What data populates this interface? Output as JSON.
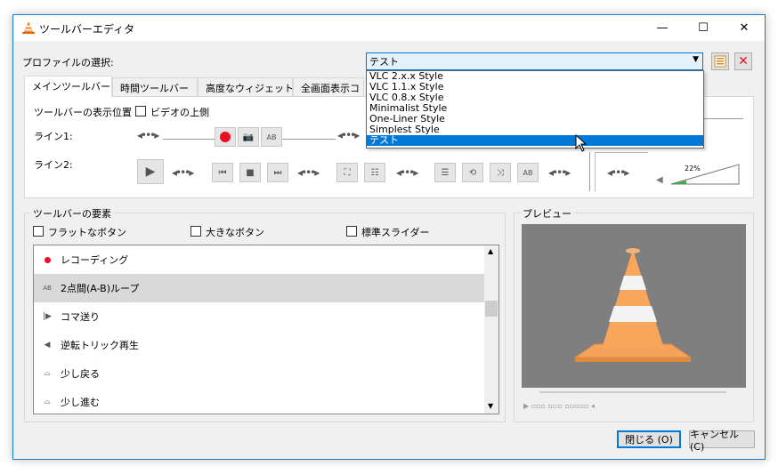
{
  "window": {
    "title": "ツールバーエディタ",
    "minimize": "—",
    "maximize": "☐",
    "close": "✕"
  },
  "profile": {
    "label": "プロファイルの選択:",
    "selected": "テスト",
    "options": [
      "VLC 2.x.x Style",
      "VLC 1.1.x Style",
      "VLC 0.8.x Style",
      "Minimalist Style",
      "One-Liner Style",
      "Simplest Style",
      "テスト"
    ]
  },
  "tabs": [
    "メインツールバー",
    "時間ツールバー",
    "高度なウィジェット",
    "全画面表示コ"
  ],
  "toolbar_position": {
    "label": "ツールバーの表示位置",
    "checkbox_label": "ビデオの上側"
  },
  "lines": {
    "line1": "ライン1:",
    "line2": "ライン2:"
  },
  "volume_percent": "22%",
  "elements_group": {
    "title": "ツールバーの要素",
    "flat_buttons": "フラットなボタン",
    "big_buttons": "大きなボタン",
    "native_slider": "標準スライダー",
    "items": [
      {
        "icon": "record-icon",
        "label": "レコーディング"
      },
      {
        "icon": "ab-loop-icon",
        "label": "2点間(A-B)ループ"
      },
      {
        "icon": "frame-step-icon",
        "label": "コマ送り"
      },
      {
        "icon": "reverse-icon",
        "label": "逆転トリック再生"
      },
      {
        "icon": "jump-back-icon",
        "label": "少し戻る"
      },
      {
        "icon": "jump-forward-icon",
        "label": "少し進む"
      }
    ]
  },
  "preview": {
    "title": "プレビュー"
  },
  "buttons": {
    "close": "閉じる (O)",
    "cancel": "キャンセル (C)"
  },
  "colors": {
    "accent": "#0078d7",
    "record_red": "#e81123",
    "cone_orange": "#f5a25d"
  }
}
